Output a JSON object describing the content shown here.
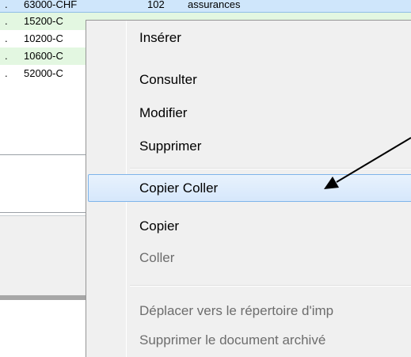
{
  "list": {
    "rows": [
      {
        "marker": ".",
        "code": "63000-CHF",
        "number": "102",
        "label": "assurances",
        "state": "selected"
      },
      {
        "marker": ".",
        "code": "15200-C",
        "number": "",
        "label": "",
        "state": "alt"
      },
      {
        "marker": ".",
        "code": "10200-C",
        "number": "",
        "label": "",
        "state": "plain"
      },
      {
        "marker": ".",
        "code": "10600-C",
        "number": "",
        "label": "",
        "state": "alt"
      },
      {
        "marker": ".",
        "code": "52000-C",
        "number": "",
        "label": "",
        "state": "plain"
      }
    ]
  },
  "context_menu": {
    "items": [
      {
        "label": "Insérer",
        "enabled": true,
        "highlighted": false
      },
      {
        "label": "Consulter",
        "enabled": true,
        "highlighted": false
      },
      {
        "label": "Modifier",
        "enabled": true,
        "highlighted": false
      },
      {
        "label": "Supprimer",
        "enabled": true,
        "highlighted": false
      },
      {
        "label": "Copier Coller",
        "enabled": true,
        "highlighted": true
      },
      {
        "label": "Copier",
        "enabled": true,
        "highlighted": false
      },
      {
        "label": "Coller",
        "enabled": false,
        "highlighted": false
      },
      {
        "label": "Déplacer vers le répertoire d'imp",
        "enabled": false,
        "highlighted": false
      },
      {
        "label": "Supprimer le document archivé",
        "enabled": false,
        "highlighted": false
      }
    ]
  },
  "colors": {
    "selected_row": "#cfe6fb",
    "alt_row": "#e3f7e1",
    "menu_background": "#f0f0f0",
    "menu_highlight_border": "#7eb4ea",
    "disabled_text": "#6d6d6d",
    "arrow": "#000000"
  },
  "annotation": {
    "icon": "pointer-arrow-icon"
  }
}
